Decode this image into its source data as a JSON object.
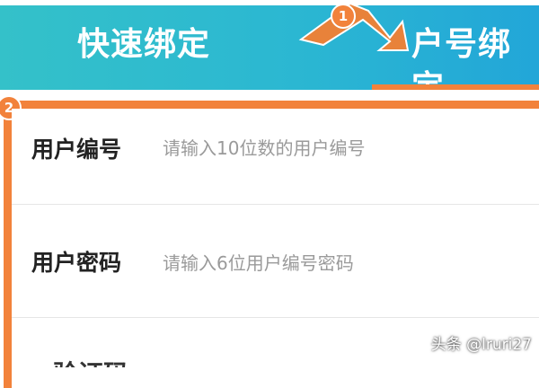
{
  "header": {
    "tabs": [
      {
        "label": "快速绑定",
        "active": false
      },
      {
        "label": "户号绑定",
        "active": true
      }
    ]
  },
  "form": {
    "fields": [
      {
        "label": "用户编号",
        "placeholder": "请输入10位数的用户编号"
      },
      {
        "label": "用户密码",
        "placeholder": "请输入6位用户编号密码"
      }
    ],
    "next_row_partial_label": "验证码"
  },
  "annotations": {
    "badge_1": "1",
    "badge_2": "2"
  },
  "watermark": "头条 @lruri27",
  "colors": {
    "header_gradient_start": "#34c1c9",
    "header_gradient_end": "#22a6d8",
    "accent_orange": "#f2823b"
  }
}
